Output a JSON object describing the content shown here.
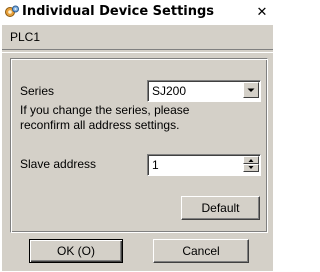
{
  "window": {
    "title": "Individual Device Settings",
    "close_glyph": "✕",
    "icon": "app-settings-icon"
  },
  "header": {
    "device": "PLC1"
  },
  "settings": {
    "series_label": "Series",
    "series_value": "SJ200",
    "note_line1": "If you change the series, please",
    "note_line2": "reconfirm all address settings.",
    "slave_label": "Slave address",
    "slave_value": "1",
    "default_label": "Default"
  },
  "footer": {
    "ok_label": "OK (O)",
    "cancel_label": "Cancel"
  }
}
